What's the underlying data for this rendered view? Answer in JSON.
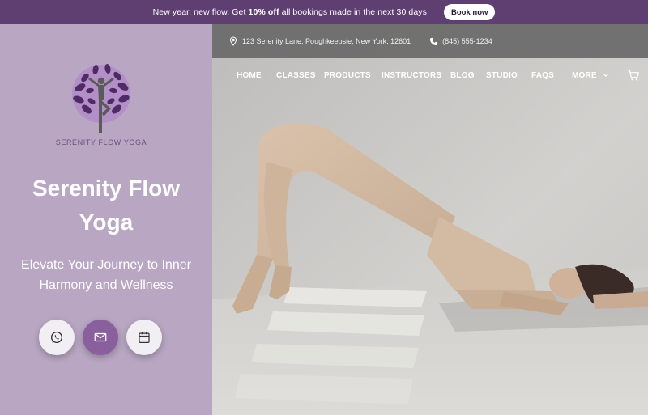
{
  "announcement": {
    "text_before": "New year, new flow. Get ",
    "text_bold": "10% off",
    "text_after": " all bookings made in the next 30 days.",
    "button_label": "Book now"
  },
  "brand": {
    "logo_text": "SERENITY FLOW YOGA",
    "title_line1": "Serenity Flow",
    "title_line2": "Yoga",
    "subtitle_line1": "Elevate Your Journey to Inner",
    "subtitle_line2": "Harmony and Wellness"
  },
  "contact": {
    "address": "123 Serenity Lane, Poughkeepsie, New York, 12601",
    "phone": "(845) 555-1234"
  },
  "nav": {
    "items": [
      "HOME",
      "CLASSES",
      "PRODUCTS",
      "INSTRUCTORS",
      "BLOG",
      "STUDIO",
      "FAQS"
    ],
    "more_label": "MORE"
  },
  "actions": {
    "icons": [
      "whatsapp-icon",
      "mail-icon",
      "calendar-icon"
    ]
  },
  "colors": {
    "announcement_bg": "#5f3f72",
    "left_panel_bg": "#b8a6c2",
    "accent_purple": "#8a5f9e",
    "logo_text": "#6d4f83"
  }
}
